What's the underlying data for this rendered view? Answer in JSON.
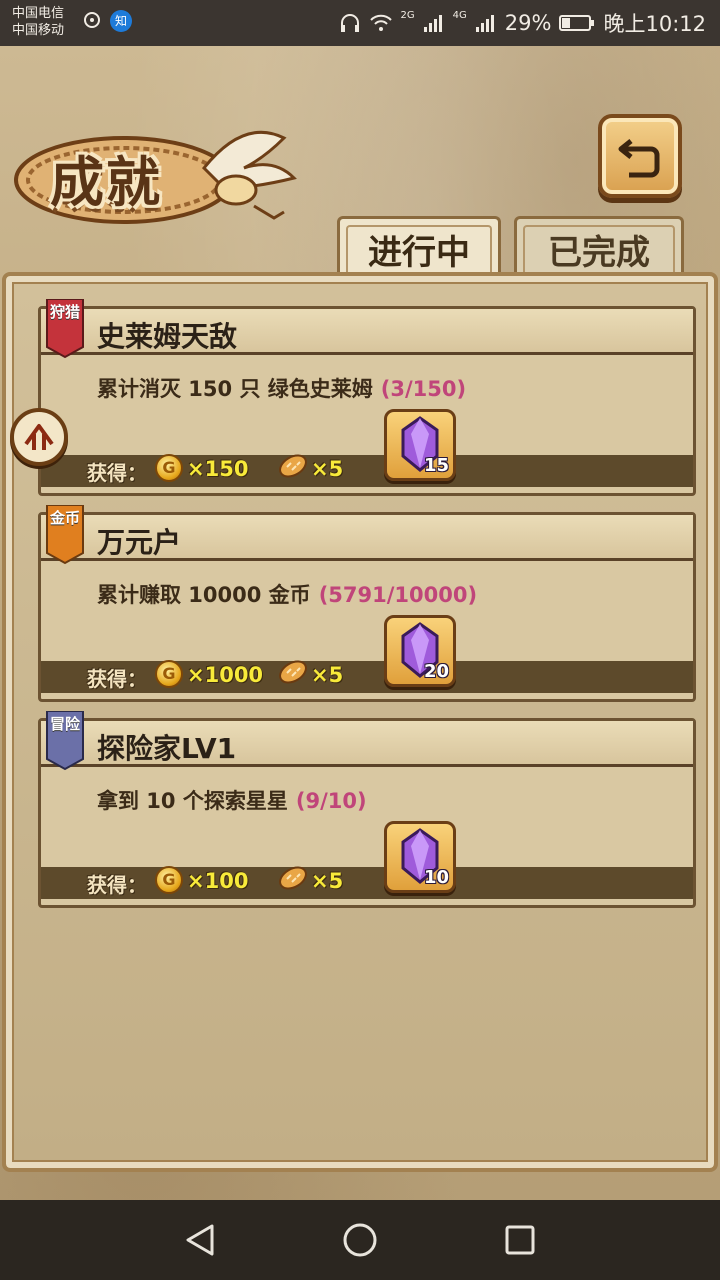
{
  "status_bar": {
    "carrier1": "中国电信",
    "carrier2": "中国移动",
    "signal_2g": "2G",
    "signal_4g": "4G",
    "battery": "29%",
    "time": "晚上10:12",
    "app_badge": "知"
  },
  "header": {
    "title": "成就"
  },
  "tabs": [
    {
      "label": "进行中",
      "active": true
    },
    {
      "label": "已完成",
      "active": false
    }
  ],
  "achievements": [
    {
      "badge": "狩猎",
      "badge_color": "#c4333b",
      "title": "史莱姆天敌",
      "description": "累计消灭 150 只 绿色史莱姆",
      "progress": "(3/150)",
      "reward_label": "获得：",
      "coin_icon": "G",
      "coins": "×150",
      "bread": "×5",
      "crystal": "15"
    },
    {
      "badge": "金币",
      "badge_color": "#e07f1f",
      "title": "万元户",
      "description": "累计赚取 10000 金币",
      "progress": "(5791/10000)",
      "reward_label": "获得：",
      "coin_icon": "G",
      "coins": "×1000",
      "bread": "×5",
      "crystal": "20"
    },
    {
      "badge": "冒险",
      "badge_color": "#6b70a8",
      "title": "探险家LV1",
      "description": "拿到 10 个探索星星",
      "progress": "(9/10)",
      "reward_label": "获得：",
      "coin_icon": "G",
      "coins": "×100",
      "bread": "×5",
      "crystal": "10"
    }
  ]
}
